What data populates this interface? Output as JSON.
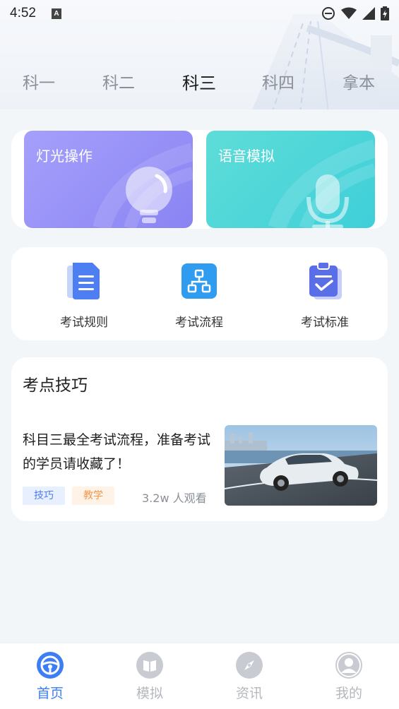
{
  "status": {
    "time": "4:52",
    "a_badge": "A"
  },
  "tabs": [
    {
      "label": "科一",
      "active": false
    },
    {
      "label": "科二",
      "active": false
    },
    {
      "label": "科三",
      "active": true
    },
    {
      "label": "科四",
      "active": false
    },
    {
      "label": "拿本",
      "active": false
    }
  ],
  "features": {
    "light": {
      "label": "灯光操作",
      "icon": "lightbulb-icon"
    },
    "voice": {
      "label": "语音模拟",
      "icon": "microphone-icon"
    }
  },
  "exam": {
    "items": [
      {
        "label": "考试规则",
        "icon": "document-icon"
      },
      {
        "label": "考试流程",
        "icon": "flowchart-icon"
      },
      {
        "label": "考试标准",
        "icon": "clipboard-check-icon"
      }
    ]
  },
  "tips": {
    "title": "考点技巧",
    "article": {
      "title": "科目三最全考试流程，准备考试的学员请收藏了！",
      "tags": [
        "技巧",
        "教学"
      ],
      "views": "3.2w 人观看"
    }
  },
  "nav": {
    "items": [
      {
        "label": "首页",
        "icon": "steering-wheel-icon",
        "active": true
      },
      {
        "label": "模拟",
        "icon": "book-icon",
        "active": false
      },
      {
        "label": "资讯",
        "icon": "compass-icon",
        "active": false
      },
      {
        "label": "我的",
        "icon": "user-icon",
        "active": false
      }
    ]
  },
  "colors": {
    "accent": "#3d7ef5",
    "light_card": "#938df7",
    "voice_card": "#4fd6d9"
  }
}
